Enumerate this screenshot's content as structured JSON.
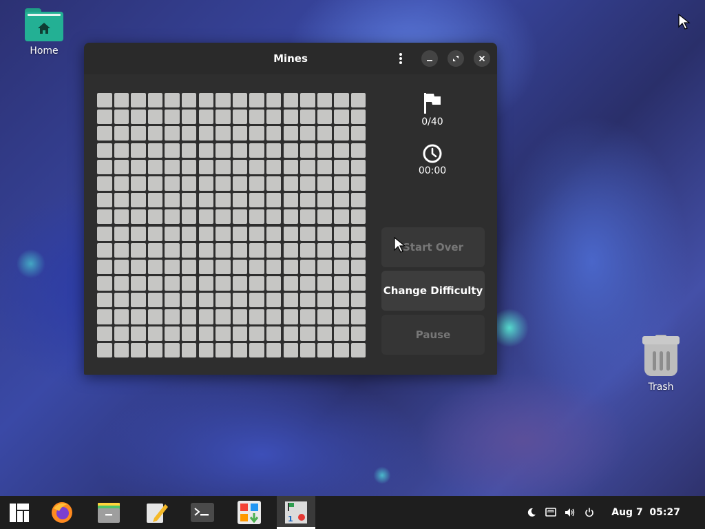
{
  "desktop": {
    "home_label": "Home",
    "trash_label": "Trash"
  },
  "window": {
    "title": "Mines",
    "board": {
      "columns": 16,
      "rows": 16,
      "state": "all covered"
    },
    "flags": {
      "value": "0/40",
      "icon": "flag-icon"
    },
    "timer": {
      "value": "00:00",
      "icon": "clock-icon"
    },
    "buttons": {
      "start_over": "Start Over",
      "change_difficulty": "Change Difficulty",
      "pause": "Pause"
    }
  },
  "taskbar": {
    "apps": [
      "menu-icon",
      "firefox-icon",
      "files-icon",
      "text-editor-icon",
      "terminal-icon",
      "software-icon",
      "mines-icon"
    ],
    "active_app": "mines-icon",
    "tray_icons": [
      "night-light-icon",
      "network-icon",
      "volume-icon",
      "power-icon"
    ],
    "clock": "Aug 7  05:27"
  },
  "colors": {
    "accent": "#23b094",
    "window_bg": "#2e2e2e",
    "cell": "#c6c6c4",
    "taskbar_bg": "#1e1e1e"
  }
}
